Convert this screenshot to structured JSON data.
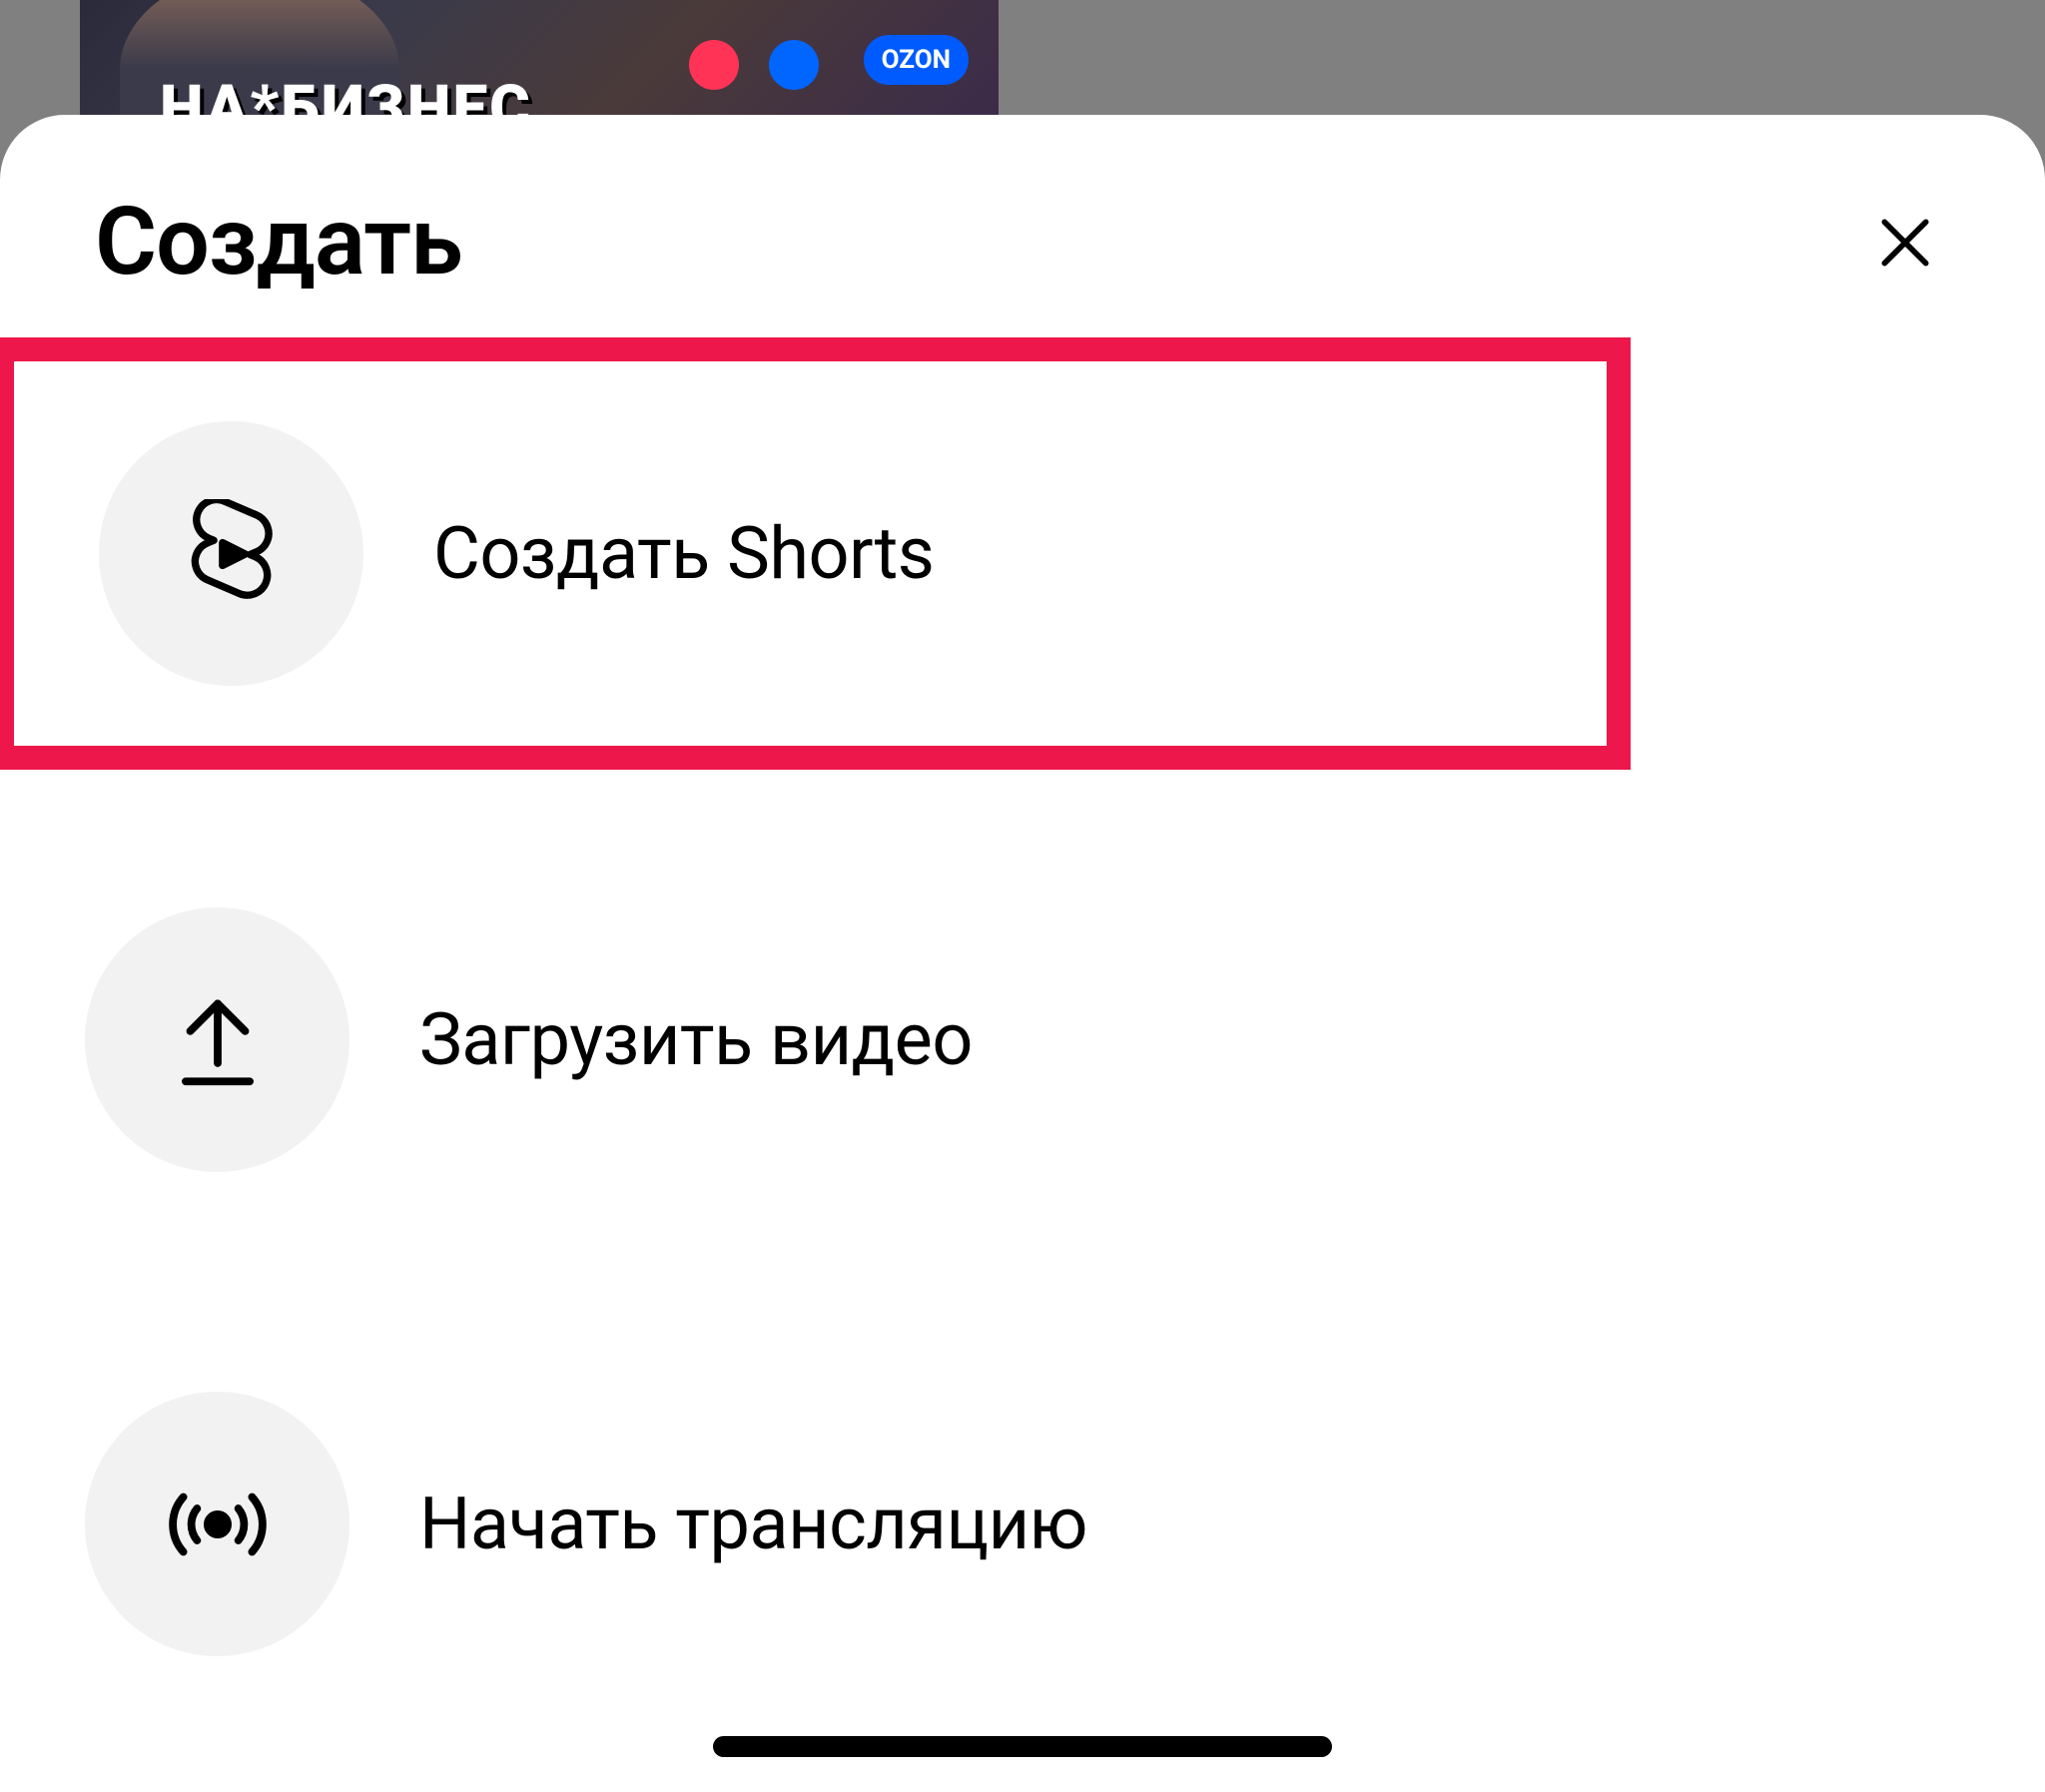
{
  "sheet": {
    "title": "Создать"
  },
  "background": {
    "thumbnail_text": "НА*БИЗНЕС",
    "badge_text": "OZON"
  },
  "options": {
    "shorts": {
      "label": "Создать Shorts"
    },
    "upload": {
      "label": "Загрузить видео"
    },
    "live": {
      "label": "Начать трансляцию"
    }
  }
}
